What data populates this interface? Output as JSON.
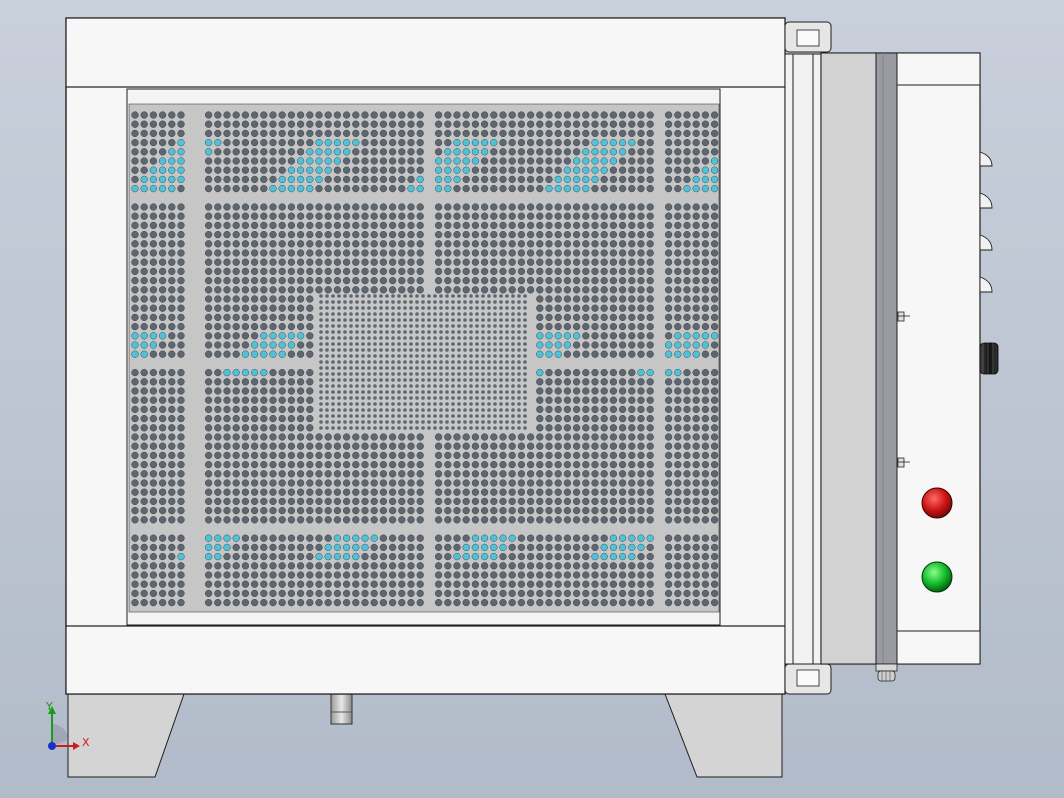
{
  "viewport": {
    "background_top": "#c9d0dc",
    "background_bottom": "#b2bbc9"
  },
  "model": {
    "panel_color": "#f7f7f7",
    "outline_color": "#1e1e1e",
    "perforated_sheet_color": "#c6c6c6",
    "hole_color": "#5e6670",
    "hole_highlight_color": "#4ec3d8",
    "door_strip_color": "#d2d2d2",
    "door_hinge_strip_color": "#9a9aa2",
    "indicator_lights": [
      {
        "name": "red-indicator-light",
        "color": "#cc1515"
      },
      {
        "name": "green-indicator-light",
        "color": "#12b92a"
      }
    ]
  },
  "triad": {
    "x_label": "X",
    "y_label": "Y",
    "x_color": "#d11a1a",
    "y_color": "#1a9a1a",
    "z_color": "#1a2fd1"
  }
}
